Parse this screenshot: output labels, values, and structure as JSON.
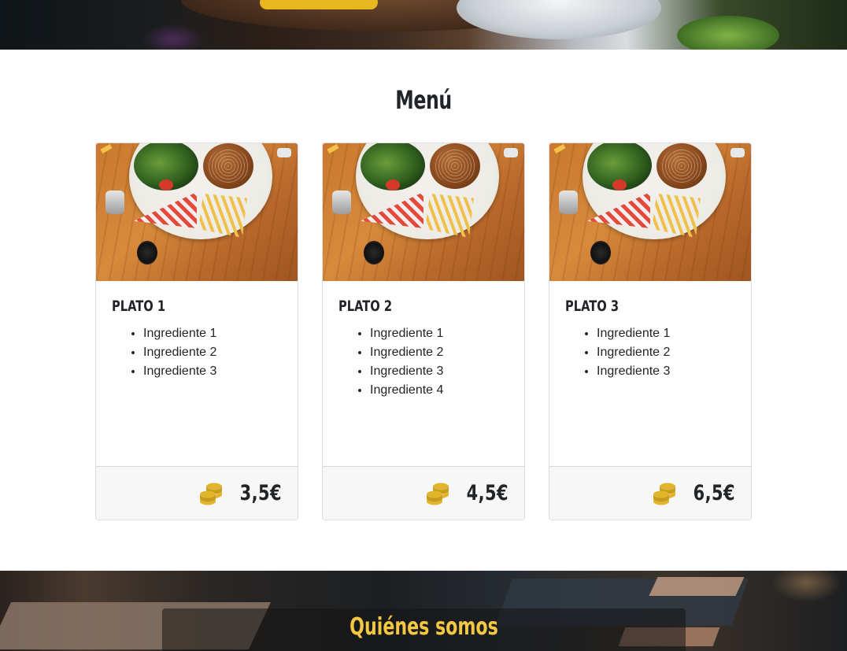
{
  "menu": {
    "title": "Menú",
    "items": [
      {
        "name": "PLATO 1",
        "ingredients": [
          "Ingrediente 1",
          "Ingrediente 2",
          "Ingrediente 3"
        ],
        "price": "3,5€"
      },
      {
        "name": "PLATO 2",
        "ingredients": [
          "Ingrediente 1",
          "Ingrediente 2",
          "Ingrediente 3",
          "Ingrediente 4"
        ],
        "price": "4,5€"
      },
      {
        "name": "PLATO 3",
        "ingredients": [
          "Ingrediente 1",
          "Ingrediente 2",
          "Ingrediente 3"
        ],
        "price": "6,5€"
      }
    ],
    "price_icon": "coins-icon"
  },
  "about": {
    "title": "Quiénes somos"
  },
  "colors": {
    "accent": "#f5c842",
    "coin": "#e1b52b",
    "footer_bg": "#f7f7f7",
    "text": "#212529"
  }
}
